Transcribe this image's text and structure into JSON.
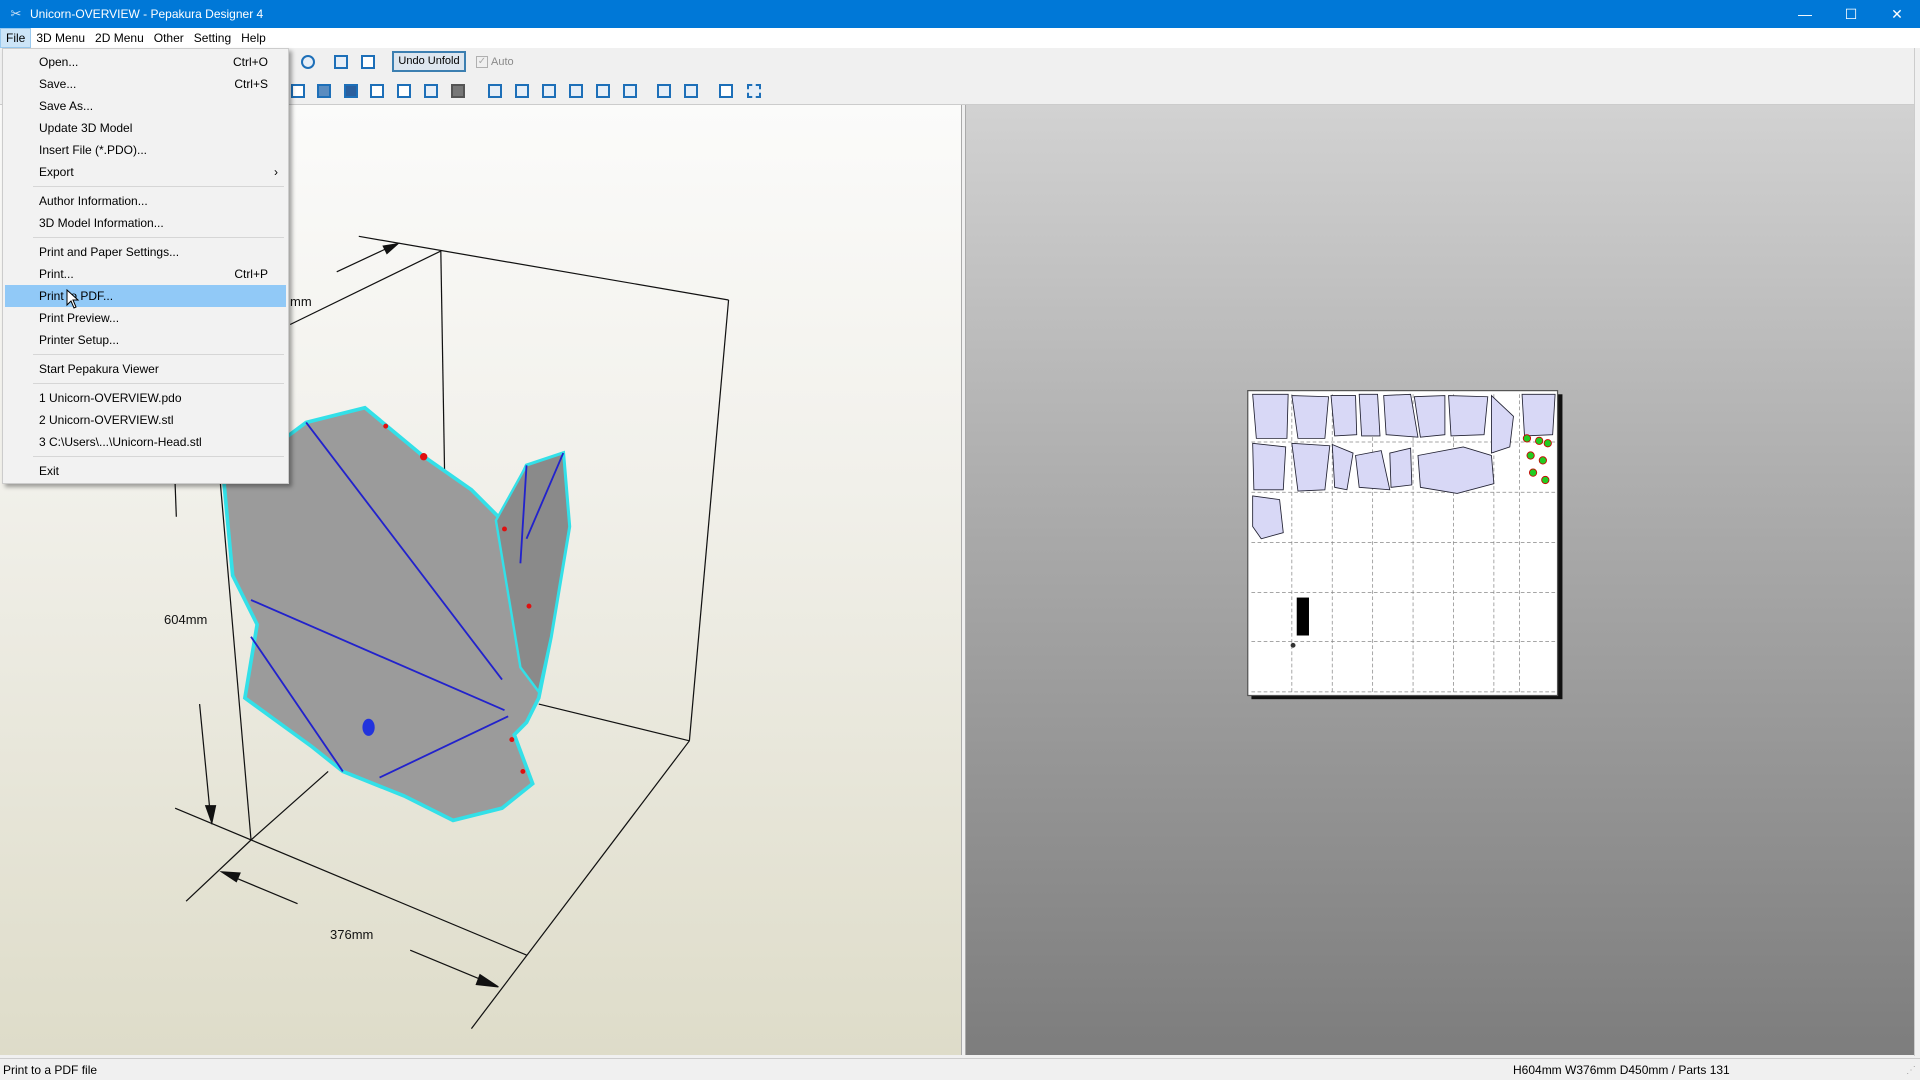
{
  "window": {
    "title": "Unicorn-OVERVIEW - Pepakura Designer 4",
    "controls": [
      "minimize",
      "maximize",
      "close"
    ]
  },
  "menubar": [
    "File",
    "3D Menu",
    "2D Menu",
    "Other",
    "Setting",
    "Help"
  ],
  "toolbar": {
    "undo_unfold": "Undo Unfold",
    "auto_label": "Auto",
    "auto_checked": true
  },
  "file_menu": {
    "groups": [
      [
        {
          "label": "Open...",
          "shortcut": "Ctrl+O"
        },
        {
          "label": "Save...",
          "shortcut": "Ctrl+S"
        },
        {
          "label": "Save As..."
        },
        {
          "label": "Update 3D Model"
        },
        {
          "label": "Insert File (*.PDO)..."
        },
        {
          "label": "Export",
          "submenu": true
        }
      ],
      [
        {
          "label": "Author Information..."
        },
        {
          "label": "3D Model Information..."
        }
      ],
      [
        {
          "label": "Print and Paper Settings..."
        },
        {
          "label": "Print...",
          "shortcut": "Ctrl+P"
        },
        {
          "label": "Print to PDF...",
          "highlighted": true
        },
        {
          "label": "Print Preview..."
        },
        {
          "label": "Printer Setup..."
        }
      ],
      [
        {
          "label": "Start Pepakura Viewer"
        }
      ],
      [
        {
          "label": "1 Unicorn-OVERVIEW.pdo"
        },
        {
          "label": "2 Unicorn-OVERVIEW.stl"
        },
        {
          "label": "3 C:\\Users\\...\\Unicorn-Head.stl"
        }
      ],
      [
        {
          "label": "Exit"
        }
      ]
    ]
  },
  "view3d": {
    "dimensions": {
      "height": "604mm",
      "width": "376mm",
      "depth": "mm"
    }
  },
  "statusbar": {
    "hint": "Print to a PDF file",
    "info": "H604mm W376mm D450mm / Parts 131"
  },
  "colors": {
    "titlebar": "#0078d7",
    "highlight": "#91c9f7",
    "model_face": "#9b9b9b",
    "model_edge": "#33e0e8",
    "crease": "#2222cc",
    "part_fill": "#d8d8f6"
  }
}
